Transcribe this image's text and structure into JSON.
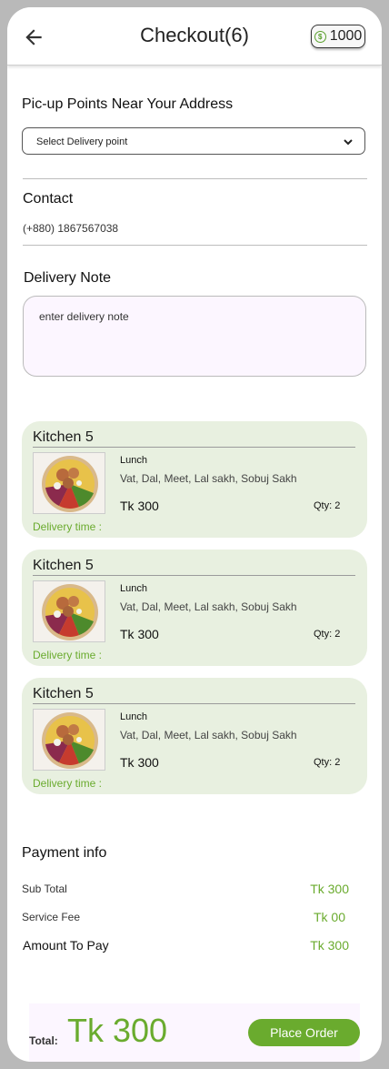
{
  "header": {
    "title": "Checkout(6)",
    "coin_balance": "1000",
    "back_icon": "arrow-left-icon",
    "coin_icon": "coin-icon"
  },
  "pickup": {
    "title": "Pic-up Points Near Your Address",
    "select_label": "Select Delivery point"
  },
  "contact": {
    "title": "Contact",
    "phone": "(+880) 1867567038"
  },
  "delivery_note": {
    "title": "Delivery Note",
    "placeholder": "enter delivery note"
  },
  "orders": [
    {
      "kitchen": "Kitchen 5",
      "meal_type": "Lunch",
      "description": "Vat, Dal, Meet, Lal sakh, Sobuj Sakh",
      "price": "Tk 300",
      "qty": "Qty: 2",
      "delivery_time": "Delivery time :"
    },
    {
      "kitchen": "Kitchen 5",
      "meal_type": "Lunch",
      "description": "Vat, Dal, Meet, Lal sakh, Sobuj Sakh",
      "price": "Tk 300",
      "qty": "Qty: 2",
      "delivery_time": "Delivery time :"
    },
    {
      "kitchen": "Kitchen 5",
      "meal_type": "Lunch",
      "description": "Vat, Dal, Meet, Lal sakh, Sobuj Sakh",
      "price": "Tk 300",
      "qty": "Qty: 2",
      "delivery_time": "Delivery time :"
    }
  ],
  "payment": {
    "title": "Payment info",
    "subtotal_label": "Sub Total",
    "subtotal_value": "Tk 300",
    "service_fee_label": "Service Fee",
    "service_fee_value": "Tk 00",
    "amount_label": "Amount To Pay",
    "amount_value": "Tk 300"
  },
  "footer": {
    "total_label": "Total:",
    "total_amount": "Tk 300",
    "place_order": "Place Order"
  },
  "colors": {
    "accent_green": "#6aab2e",
    "card_bg": "#e8f0e0",
    "note_bg": "#fcf6ff"
  }
}
